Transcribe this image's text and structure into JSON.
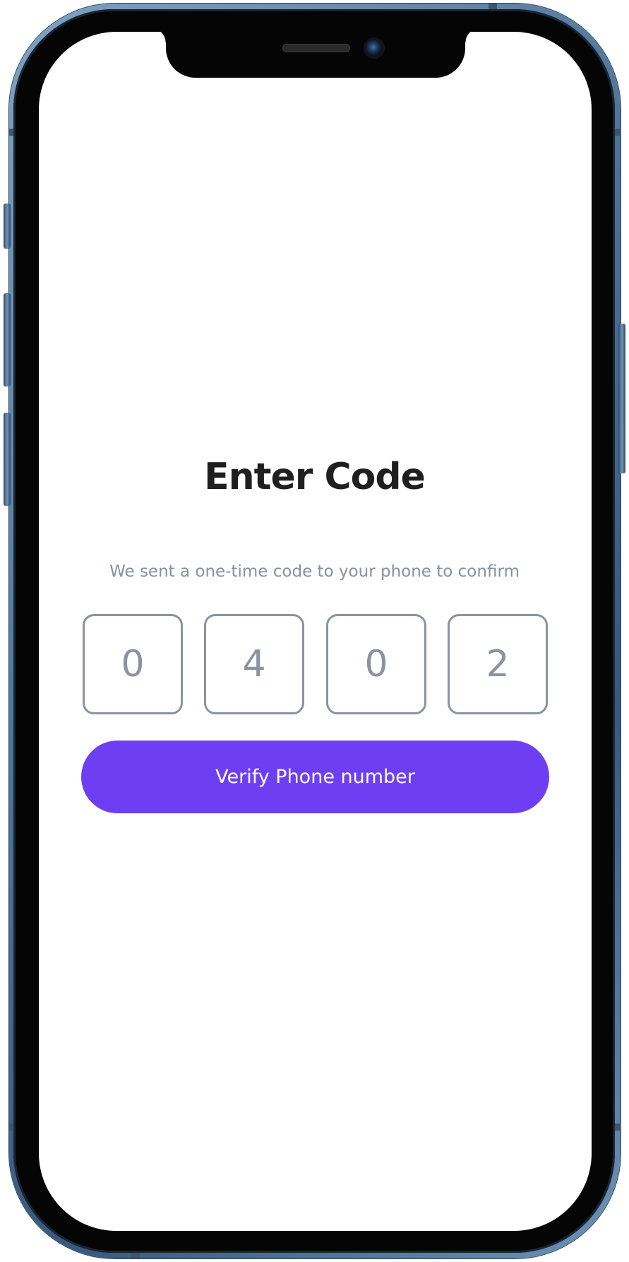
{
  "screen": {
    "title": "Enter Code",
    "subtitle": "We sent a one-time code to your phone to confirm",
    "code_digits": [
      "0",
      "4",
      "0",
      "2"
    ],
    "verify_button_label": "Verify Phone number"
  },
  "colors": {
    "accent": "#6e3ff2",
    "title_text": "#1f1f1f",
    "muted_text": "#8791a3",
    "code_border": "#8a93a3",
    "phone_frame": "#4e7498"
  }
}
